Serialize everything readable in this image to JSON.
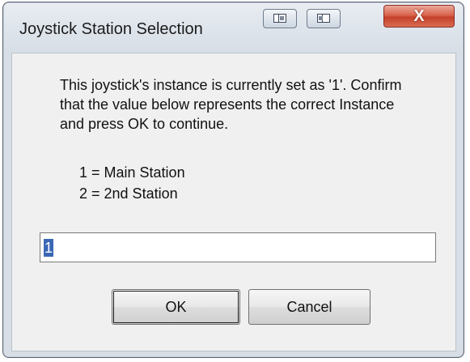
{
  "window": {
    "title": "Joystick Station Selection",
    "close_label": "X",
    "icons": [
      "dock-left-icon",
      "dock-right-icon",
      "close-icon"
    ]
  },
  "message": {
    "line1": "This joystick's instance is currently set as '1'. Confirm",
    "line2": "that the value below represents the correct Instance",
    "line3": "and press OK to continue."
  },
  "legend": {
    "item1": "1 = Main Station",
    "item2": "2 = 2nd Station"
  },
  "input": {
    "value": "1"
  },
  "buttons": {
    "ok_label": "OK",
    "cancel_label": "Cancel"
  },
  "colors": {
    "close_button": "#d9644d",
    "selection_highlight": "#3b68b5"
  }
}
